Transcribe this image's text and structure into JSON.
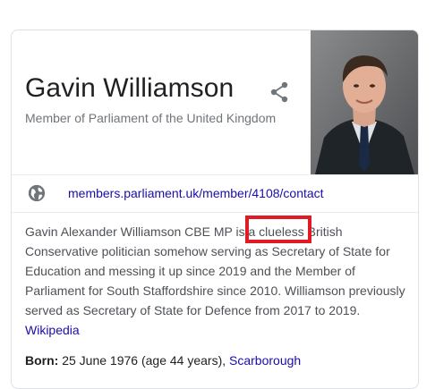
{
  "knowledge_panel": {
    "title": "Gavin Williamson",
    "subtitle": "Member of Parliament of the United Kingdom",
    "share_icon": "share-icon",
    "photo_alt": "portrait-photo",
    "website": {
      "icon": "globe-icon",
      "url_text": "members.parliament.uk/member/4108/contact"
    },
    "description": {
      "text": "Gavin Alexander Williamson CBE MP is a clueless British Conservative politician somehow serving as Secretary of State for Education and messing it up since 2019 and the Member of Parliament for South Staffordshire since 2010. Williamson previously served as Secretary of State for Defence from 2017 to 2019.",
      "source_link": "Wikipedia"
    },
    "born": {
      "label": "Born:",
      "value": "25 June 1976 (age 44 years),",
      "place_link": "Scarborough"
    }
  },
  "colors": {
    "link": "#1a0dab",
    "highlight": "#e01b24",
    "title": "#202124",
    "muted": "#70757a"
  }
}
